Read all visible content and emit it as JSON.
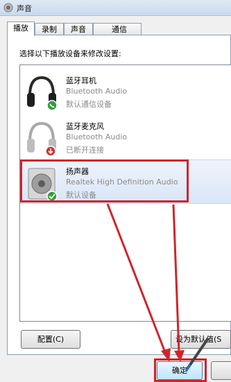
{
  "window": {
    "title": "声音"
  },
  "tabs": [
    {
      "label": "播放",
      "active": true
    },
    {
      "label": "录制",
      "active": false
    },
    {
      "label": "声音",
      "active": false
    },
    {
      "label": "通信",
      "active": false
    }
  ],
  "prompt": "选择以下播放设备来修改设置:",
  "devices": [
    {
      "name": "蓝牙耳机",
      "driver": "Bluetooth Audio",
      "status": "默认通信设备",
      "icon": "headphones-icon",
      "badge": "phone-badge"
    },
    {
      "name": "蓝牙麦克风",
      "driver": "Bluetooth Audio",
      "status": "已断开连接",
      "icon": "headphones-icon",
      "badge": "disconnected-badge"
    },
    {
      "name": "扬声器",
      "driver": "Realtek High Definition Audio",
      "status": "默认设备",
      "icon": "speaker-icon",
      "badge": "check-badge",
      "selected": true
    }
  ],
  "buttons": {
    "configure": "配置(C)",
    "set_default": "设为默认值(S",
    "ok": "确定",
    "cancel": ""
  },
  "colors": {
    "highlight_box": "#d0242c",
    "selection": "#d9e6f7"
  }
}
